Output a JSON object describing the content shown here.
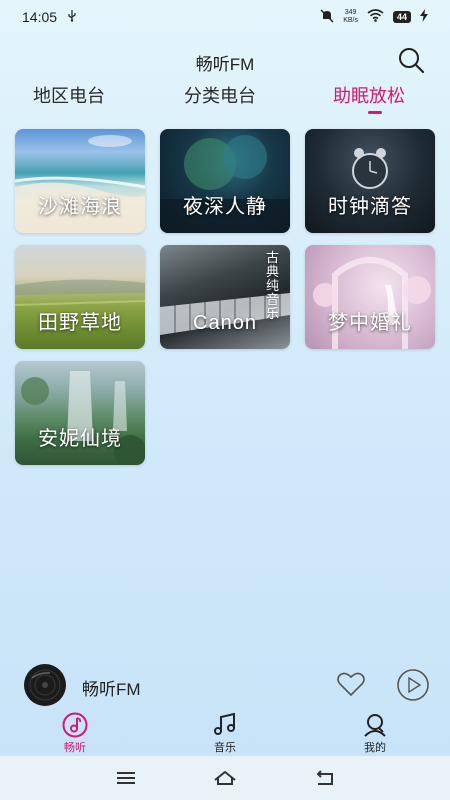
{
  "status": {
    "time": "14:05",
    "usb_icon": "usb-icon",
    "net_speed_value": "349",
    "net_speed_unit": "KB/s",
    "battery": "44"
  },
  "header": {
    "title": "畅听FM"
  },
  "tabs": [
    {
      "label": "地区电台"
    },
    {
      "label": "分类电台"
    },
    {
      "label": "助眠放松"
    }
  ],
  "active_tab_index": 2,
  "cards": [
    {
      "label": "沙滩海浪"
    },
    {
      "label": "夜深人静"
    },
    {
      "label": "时钟滴答"
    },
    {
      "label": "田野草地"
    },
    {
      "label": "Canon"
    },
    {
      "label": "梦中婚礼"
    },
    {
      "label": "安妮仙境"
    }
  ],
  "piano_vertical_text": "古典纯音乐",
  "player": {
    "title": "畅听FM"
  },
  "bottom_nav": [
    {
      "label": "畅听",
      "icon": "music-note-circle-icon",
      "active": true
    },
    {
      "label": "音乐",
      "icon": "music-notes-icon",
      "active": false
    },
    {
      "label": "我的",
      "icon": "user-icon",
      "active": false
    }
  ],
  "colors": {
    "accent": "#d11a74",
    "background_top": "#e4f5fb",
    "background_bottom": "#c7e2f8"
  }
}
